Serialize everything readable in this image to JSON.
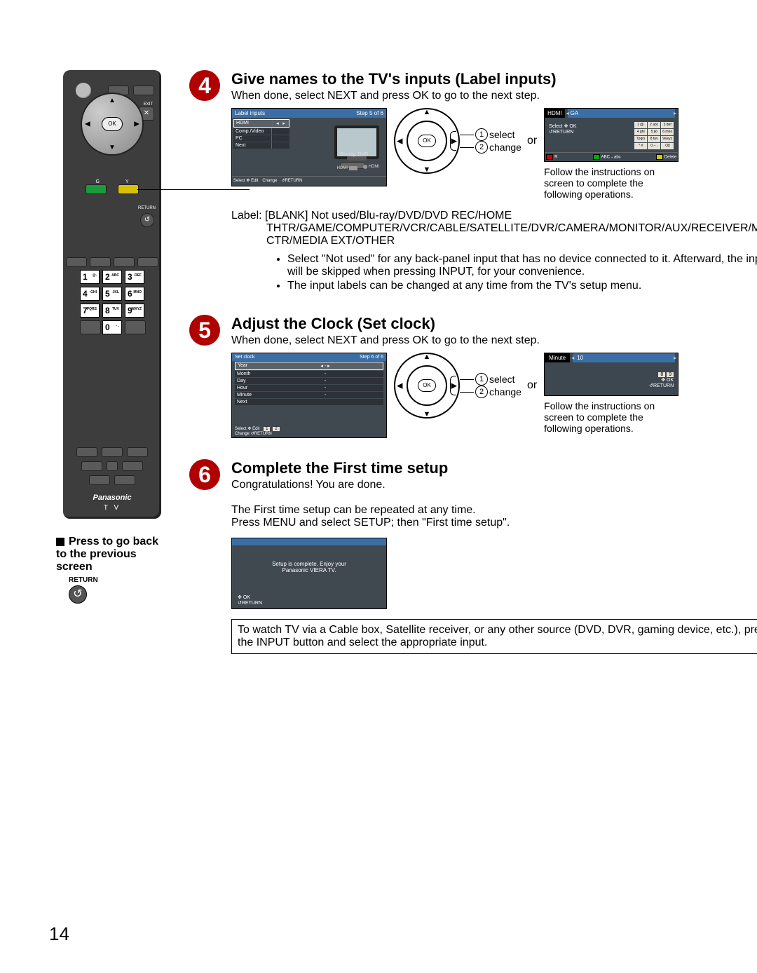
{
  "page_number": "14",
  "remote": {
    "exit_label": "EXIT",
    "return_label": "RETURN",
    "ok": "OK",
    "g": "G",
    "y": "Y",
    "brand": "Panasonic",
    "model": "T V",
    "keys": [
      {
        "n": "1",
        "s": "@."
      },
      {
        "n": "2",
        "s": "ABC"
      },
      {
        "n": "3",
        "s": "DEF"
      },
      {
        "n": "4",
        "s": "GHI"
      },
      {
        "n": "5",
        "s": "JKL"
      },
      {
        "n": "6",
        "s": "MNO"
      },
      {
        "n": "7",
        "s": "PQRS"
      },
      {
        "n": "8",
        "s": "TUV"
      },
      {
        "n": "9",
        "s": "WXYZ"
      },
      {
        "n": "0",
        "s": "- ."
      }
    ]
  },
  "prev_screen": {
    "text": "Press to go back to the previous screen",
    "return_label": "RETURN",
    "return_glyph": "↺"
  },
  "step4": {
    "num": "4",
    "title": "Give names to the TV's inputs (Label inputs)",
    "subtitle": "When done, select NEXT and press OK to go to the next step.",
    "osd": {
      "title": "Label inputs",
      "step": "Step 5 of 6",
      "rows": [
        "HDMI",
        "Comp./Video",
        "PC",
        "Next"
      ],
      "caption": "Blu-ray, DVD ...",
      "port1": "HDMI",
      "port2": "HDMI",
      "footer_select": "Select",
      "footer_edit": "Edit",
      "footer_change": "Change",
      "footer_return": "RETURN",
      "footer_abc": "ABC→abc",
      "footer_delete": "Delete"
    },
    "dpad": {
      "ok": "OK",
      "sel_label": "select",
      "chg_label": "change",
      "or": "or"
    },
    "osd2": {
      "field": "HDMI",
      "value": "GA",
      "inst_select": "Select",
      "inst_ok": "OK",
      "inst_return": "RETURN",
      "keys": [
        "1 @.",
        "2 abc",
        "3 def",
        "4 ghi",
        "5 jkl",
        "6 mno",
        "7pqrs",
        "8 tuv",
        "9wxyz",
        "* #",
        "0 – .",
        "⌫"
      ],
      "foot_r": "R",
      "foot_abc": "ABC→abc",
      "foot_del": "Delete"
    },
    "follow": "Follow the instructions on screen to complete the following operations.",
    "label_list": "Label: [BLANK] Not used/Blu-ray/DVD/DVD REC/HOME THTR/GAME/COMPUTER/VCR/CABLE/SATELLITE/DVR/CAMERA/MONITOR/AUX/RECEIVER/MEDIA CTR/MEDIA EXT/OTHER",
    "notes": [
      "Select \"Not used\" for any back-panel input that has no device connected to it. Afterward, the input will be skipped when pressing INPUT, for your convenience.",
      "The input labels can be changed at any time from the TV's setup menu."
    ]
  },
  "step5": {
    "num": "5",
    "title": "Adjust the Clock (Set clock)",
    "subtitle": "When done, select NEXT and press OK to go to the next step.",
    "osd": {
      "title": "Set clock",
      "step": "Step 6 of 6",
      "rows": [
        [
          "Year",
          "-"
        ],
        [
          "Month",
          "-"
        ],
        [
          "Day",
          "-"
        ],
        [
          "Hour",
          "-"
        ],
        [
          "Minute",
          "-"
        ],
        [
          "Next",
          ""
        ]
      ],
      "footer_select": "Select",
      "footer_edit": "Edit",
      "footer_change": "Change",
      "footer_return": "RETURN"
    },
    "dpad": {
      "ok": "OK",
      "sel_label": "select",
      "chg_label": "change",
      "or": "or"
    },
    "osd3": {
      "field": "Minute",
      "value": "10",
      "inst_ok": "OK",
      "inst_return": "RETURN",
      "key8": "8",
      "key9": "9"
    },
    "follow": "Follow the instructions on screen to complete the following operations."
  },
  "step6": {
    "num": "6",
    "title": "Complete the First time setup",
    "subtitle": "Congratulations!  You are done.",
    "para1": "The First time setup can be repeated at any time.",
    "para2": "Press MENU and select SETUP; then \"First time setup\".",
    "osd": {
      "msg1": "Setup is complete. Enjoy your",
      "msg2": "Panasonic VIERA TV.",
      "foot_ok": "OK",
      "foot_return": "RETURN"
    },
    "box": "To watch TV via a Cable box, Satellite receiver, or  any other source (DVD, DVR, gaming device, etc.), press the INPUT button and select the appropriate input."
  }
}
